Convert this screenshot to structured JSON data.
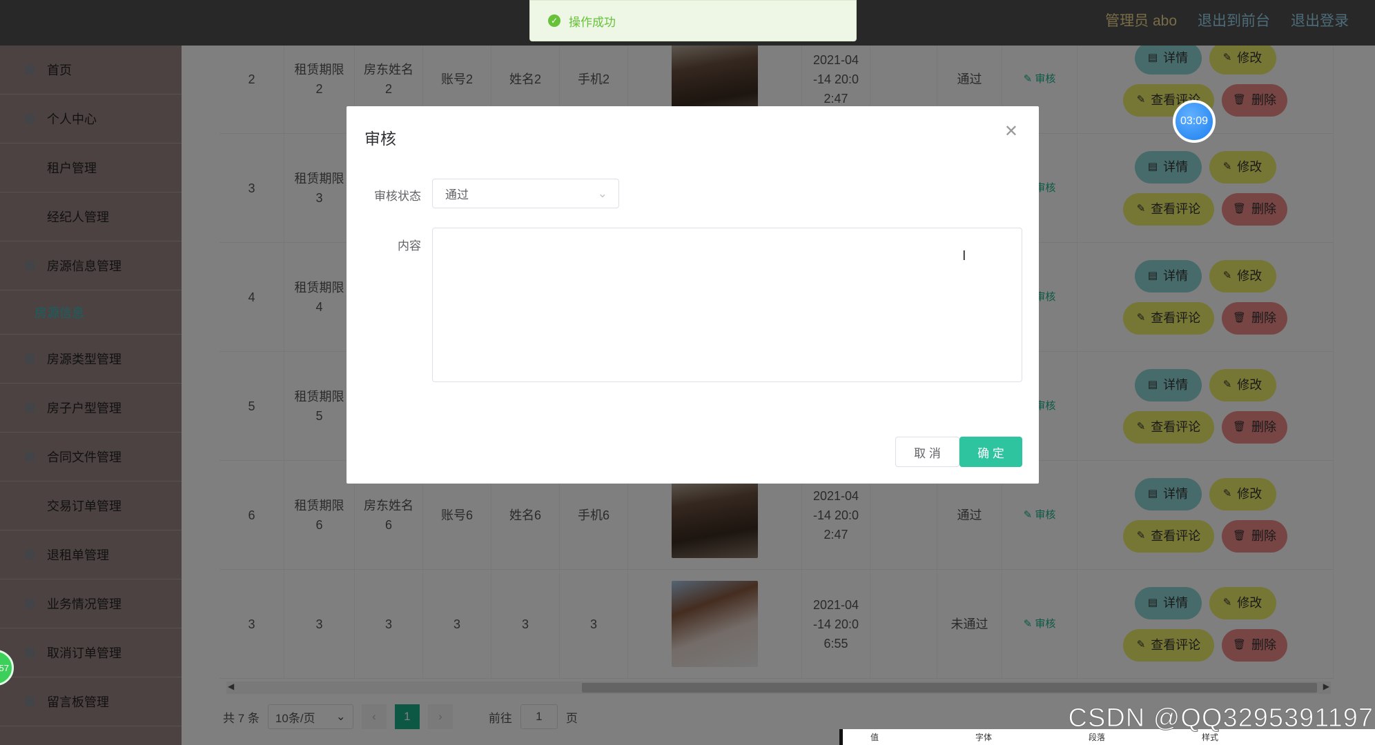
{
  "topbar": {
    "admin": "管理员 abo",
    "to_front": "退出到前台",
    "logout": "退出登录"
  },
  "toast": {
    "message": "操作成功",
    "icon": "check-circle-icon"
  },
  "sidebar": {
    "items": [
      "首页",
      "个人中心",
      "租户管理",
      "经纪人管理",
      "房源信息管理",
      "房源类型管理",
      "房子户型管理",
      "合同文件管理",
      "交易订单管理",
      "退租单管理",
      "业务情况管理",
      "取消订单管理",
      "留言板管理"
    ],
    "active_sub": "房源信息"
  },
  "table": {
    "rows": [
      {
        "index": "2",
        "lease": "租赁期限2",
        "owner": "房东姓名2",
        "account": "账号2",
        "name": "姓名2",
        "phone": "手机2",
        "date": "2021-04-14 20:02:47",
        "status": "通过",
        "image": "room-dark"
      },
      {
        "index": "3",
        "lease": "租赁期限3",
        "owner": "",
        "account": "",
        "name": "",
        "phone": "",
        "date": "",
        "status": "",
        "image": ""
      },
      {
        "index": "4",
        "lease": "租赁期限4",
        "owner": "",
        "account": "",
        "name": "",
        "phone": "",
        "date": "",
        "status": "",
        "image": ""
      },
      {
        "index": "5",
        "lease": "租赁期限5",
        "owner": "",
        "account": "",
        "name": "",
        "phone": "",
        "date": "",
        "status": "",
        "image": ""
      },
      {
        "index": "6",
        "lease": "租赁期限6",
        "owner": "房东姓名6",
        "account": "账号6",
        "name": "姓名6",
        "phone": "手机6",
        "date": "2021-04-14 20:02:47",
        "status": "通过",
        "image": "room-dark"
      },
      {
        "index": "3",
        "lease": "3",
        "owner": "3",
        "account": "3",
        "name": "3",
        "phone": "3",
        "date": "2021-04-14 20:06:55",
        "status": "未通过",
        "image": "portrait"
      }
    ],
    "review_label": "审核",
    "actions": {
      "detail": "详情",
      "edit": "修改",
      "comments": "查看评论",
      "delete": "删除"
    }
  },
  "pagination": {
    "total": "共 7 条",
    "page_size": "10条/页",
    "current": "1",
    "goto_prefix": "前往",
    "goto_value": "1",
    "goto_suffix": "页"
  },
  "modal": {
    "title": "审核",
    "status_label": "审核状态",
    "status_value": "通过",
    "content_label": "内容",
    "content_value": "",
    "cancel": "取 消",
    "confirm": "确 定"
  },
  "overlays": {
    "timer": "03:09",
    "bubble": "57",
    "watermark": "CSDN @QQ3295391197",
    "ribbon": [
      "值",
      "字体",
      "段落",
      "样式"
    ]
  },
  "colors": {
    "accent": "#18b08a",
    "confirm": "#2ec4a0",
    "detail": "#8fd5d5",
    "edit": "#eded6a",
    "delete": "#f08a8a",
    "toast": "#67c23a"
  }
}
